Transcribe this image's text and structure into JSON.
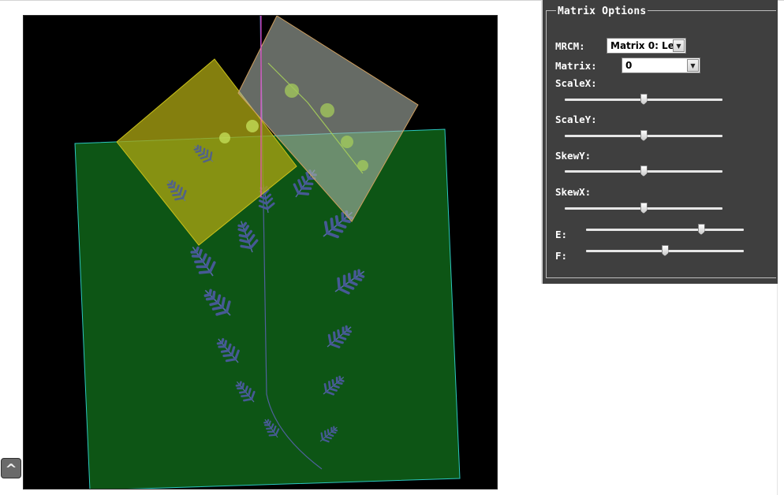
{
  "panel": {
    "legend": "Matrix Options",
    "mrcm_label": "MRCM:",
    "mrcm_value": "Matrix 0: Le",
    "matrix_label": "Matrix:",
    "matrix_value": "0",
    "sliders": [
      {
        "label": "ScaleX:",
        "value": 0.5
      },
      {
        "label": "ScaleY:",
        "value": 0.5
      },
      {
        "label": "SkewY:",
        "value": 0.5
      },
      {
        "label": "SkewX:",
        "value": 0.5
      },
      {
        "label": "E:",
        "value": 0.73
      },
      {
        "label": "F:",
        "value": 0.5
      }
    ]
  },
  "scroll_up_glyph": "^",
  "colors": {
    "canvas_bg": "#000000",
    "panel_bg": "#3f3f3f",
    "green_quad": "#0e5a16",
    "yellow_quad": "#a9a312",
    "grey_quad": "#aab3a8",
    "fern": "#4a5a9c",
    "fern_highlight": "#a7d05a"
  }
}
